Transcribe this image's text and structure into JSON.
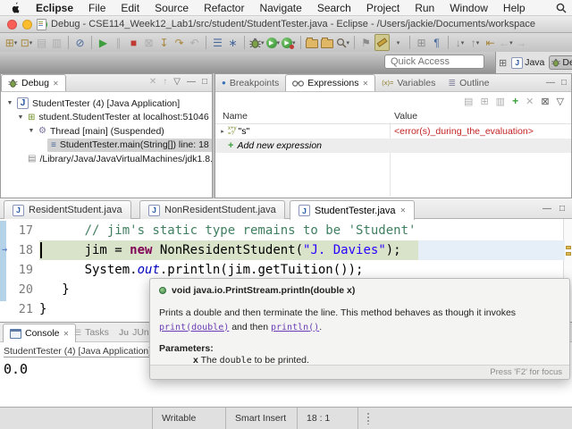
{
  "menubar": {
    "items": [
      "Eclipse",
      "File",
      "Edit",
      "Source",
      "Refactor",
      "Navigate",
      "Search",
      "Project",
      "Run",
      "Window",
      "Help"
    ]
  },
  "window": {
    "title": "Debug - CSE114_Week12_Lab1/src/student/StudentTester.java - Eclipse - /Users/jackie/Documents/workspace"
  },
  "toolbar": {
    "quick_access_placeholder": "Quick Access",
    "java_perspective": "Java",
    "debug_perspective": "Debug"
  },
  "icons": {
    "dropdown": "▾",
    "tree_expanded": "▼",
    "tree_collapsed": "▸",
    "new_wizard": "⊞",
    "new_element": "⊡",
    "save": "▤",
    "save_all": "▥",
    "skip_breakpoints": "⊘",
    "resume": "▶",
    "suspend": "∥",
    "terminate": "■",
    "disconnect": "⊠",
    "step_into": "↧",
    "step_over": "↷",
    "step_return": "↶",
    "lines": "☰",
    "star": "∗",
    "gear": "⚙",
    "pin": "⚑",
    "segment": "⊞",
    "pilcrow": "¶",
    "down_arrow": "↓",
    "up_arrow": "↑",
    "last_edit": "⇤",
    "back": "←",
    "forward": "→",
    "view_menu": "▽",
    "minimize": "—",
    "maximize": "□",
    "close": "✕",
    "stack_frame": "≡",
    "outline": "≣",
    "variables_badge": "(x)=",
    "expr_badge_top": "x+y",
    "expr_badge_bottom": "=?",
    "breakpoint_dot": "●",
    "tasks": "☰",
    "jvm": "▤",
    "thread": "⚙",
    "java_letter": "J",
    "play": "▶",
    "plus": "+"
  },
  "debug_view": {
    "title": "Debug",
    "rows": [
      {
        "label": "StudentTester (4) [Java Application]"
      },
      {
        "label": "student.StudentTester at localhost:51046"
      },
      {
        "label": "Thread [main] (Suspended)"
      },
      {
        "label": "StudentTester.main(String[]) line: 18"
      },
      {
        "label": "/Library/Java/JavaVirtualMachines/jdk1.8."
      }
    ]
  },
  "expressions_view": {
    "tabs": [
      "Breakpoints",
      "Expressions",
      "Variables",
      "Outline"
    ],
    "columns": [
      "Name",
      "Value"
    ],
    "rows": [
      {
        "name": "\"s\"",
        "value": "<error(s)_during_the_evaluation>"
      },
      {
        "name": "Add new expression",
        "value": ""
      }
    ]
  },
  "editor": {
    "tabs": [
      "ResidentStudent.java",
      "NonResidentStudent.java",
      "StudentTester.java"
    ],
    "lines": [
      {
        "num": "17",
        "tokens": [
          {
            "t": "      // jim's static type remains to be 'Student'"
          }
        ]
      },
      {
        "num": "18",
        "tokens": [
          {
            "t": "      jim = "
          },
          {
            "t": "new"
          },
          {
            "t": " NonResidentStudent("
          },
          {
            "t": "\"J. Davies\""
          },
          {
            "t": ");"
          }
        ]
      },
      {
        "num": "19",
        "tokens": [
          {
            "t": "      System."
          },
          {
            "t": "out"
          },
          {
            "t": ".println(jim.getTuition());"
          }
        ]
      },
      {
        "num": "20",
        "tokens": [
          {
            "t": "   }"
          }
        ]
      },
      {
        "num": "21",
        "tokens": [
          {
            "t": "}"
          }
        ]
      }
    ]
  },
  "tooltip": {
    "signature": "void java.io.PrintStream.println(double x)",
    "body_1": "Prints a double and then terminate the line. This method behaves as though it invokes ",
    "link_1": "print(double)",
    "body_2": " and then ",
    "link_2": "println()",
    "body_3": ".",
    "params_label": "Parameters:",
    "param_name": "x",
    "param_pre": " The ",
    "param_code": "double",
    "param_post": " to be printed.",
    "footer": "Press 'F2' for focus"
  },
  "console": {
    "tabs": [
      "Console",
      "Tasks",
      "JUnit"
    ],
    "junit_icon": "Ju",
    "title": "StudentTester (4) [Java Application] /",
    "output": "0.0"
  },
  "statusbar": {
    "writable": "Writable",
    "smart_insert": "Smart Insert",
    "position": "18 : 1"
  },
  "colors": {
    "current_line_highlight": "#d9e3ca",
    "error_text": "#c32222",
    "keyword": "#7f0055",
    "string": "#2a00ff",
    "comment": "#3f7f5f",
    "static_field": "#0000c0"
  }
}
